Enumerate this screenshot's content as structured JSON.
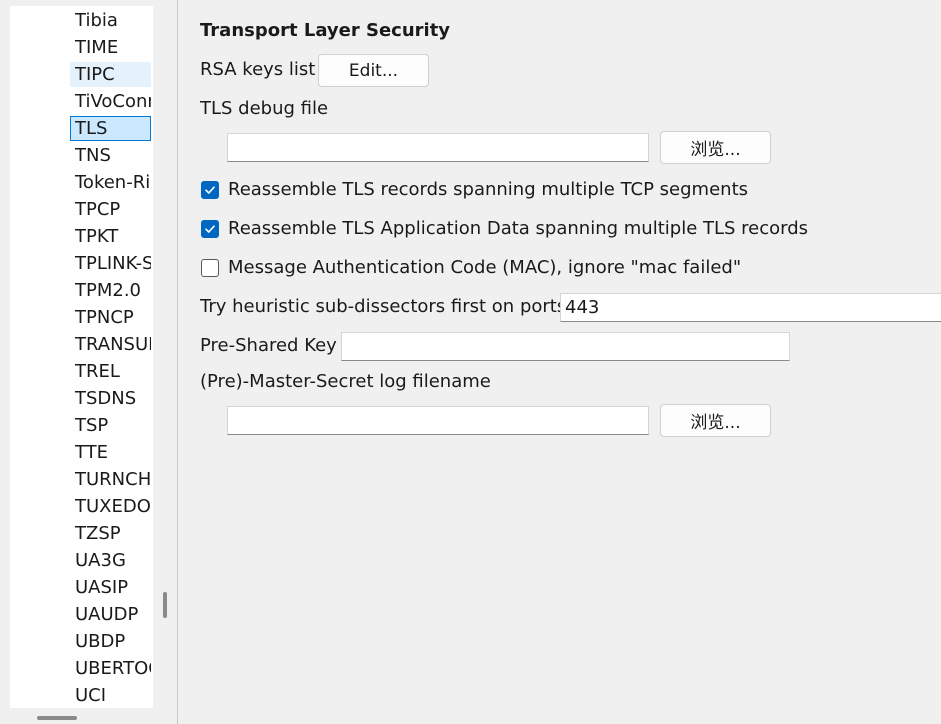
{
  "tree": {
    "items": [
      {
        "label": "Tibia",
        "state": "normal"
      },
      {
        "label": "TIME",
        "state": "normal"
      },
      {
        "label": "TIPC",
        "state": "hover"
      },
      {
        "label": "TiVoConnect",
        "state": "normal"
      },
      {
        "label": "TLS",
        "state": "selected"
      },
      {
        "label": "TNS",
        "state": "normal"
      },
      {
        "label": "Token-Ring",
        "state": "normal"
      },
      {
        "label": "TPCP",
        "state": "normal"
      },
      {
        "label": "TPKT",
        "state": "normal"
      },
      {
        "label": "TPLINK-SMARTHOME",
        "state": "normal"
      },
      {
        "label": "TPM2.0",
        "state": "normal"
      },
      {
        "label": "TPNCP",
        "state": "normal"
      },
      {
        "label": "TRANSUM",
        "state": "normal"
      },
      {
        "label": "TREL",
        "state": "normal"
      },
      {
        "label": "TSDNS",
        "state": "normal"
      },
      {
        "label": "TSP",
        "state": "normal"
      },
      {
        "label": "TTE",
        "state": "normal"
      },
      {
        "label": "TURNCHANNEL",
        "state": "normal"
      },
      {
        "label": "TUXEDO",
        "state": "normal"
      },
      {
        "label": "TZSP",
        "state": "normal"
      },
      {
        "label": "UA3G",
        "state": "normal"
      },
      {
        "label": "UASIP",
        "state": "normal"
      },
      {
        "label": "UAUDP",
        "state": "normal"
      },
      {
        "label": "UBDP",
        "state": "normal"
      },
      {
        "label": "UBERTOOTH",
        "state": "normal"
      },
      {
        "label": "UCI",
        "state": "normal"
      }
    ]
  },
  "prefs": {
    "title": "Transport Layer Security",
    "rsa_keys_label": "RSA keys list",
    "rsa_keys_button": "Edit...",
    "debug_file_label": "TLS debug file",
    "debug_file_value": "",
    "debug_browse_button": "浏览...",
    "reassemble_records": {
      "label": "Reassemble TLS records spanning multiple TCP segments",
      "checked": true
    },
    "reassemble_appdata": {
      "label": "Reassemble TLS Application Data spanning multiple TLS records",
      "checked": true
    },
    "ignore_mac": {
      "label": "Message Authentication Code (MAC), ignore \"mac failed\"",
      "checked": false
    },
    "heuristic_label": "Try heuristic sub-dissectors first on ports",
    "heuristic_value": "443",
    "psk_label": "Pre-Shared Key",
    "psk_value": "",
    "master_secret_label": "(Pre)-Master-Secret log filename",
    "master_secret_value": "",
    "master_browse_button": "浏览..."
  },
  "colors": {
    "checkbox_accent": "#0067c0",
    "selection_fill": "#cce8ff",
    "selection_border": "#0078d7",
    "hover_fill": "#e5f1fb"
  }
}
